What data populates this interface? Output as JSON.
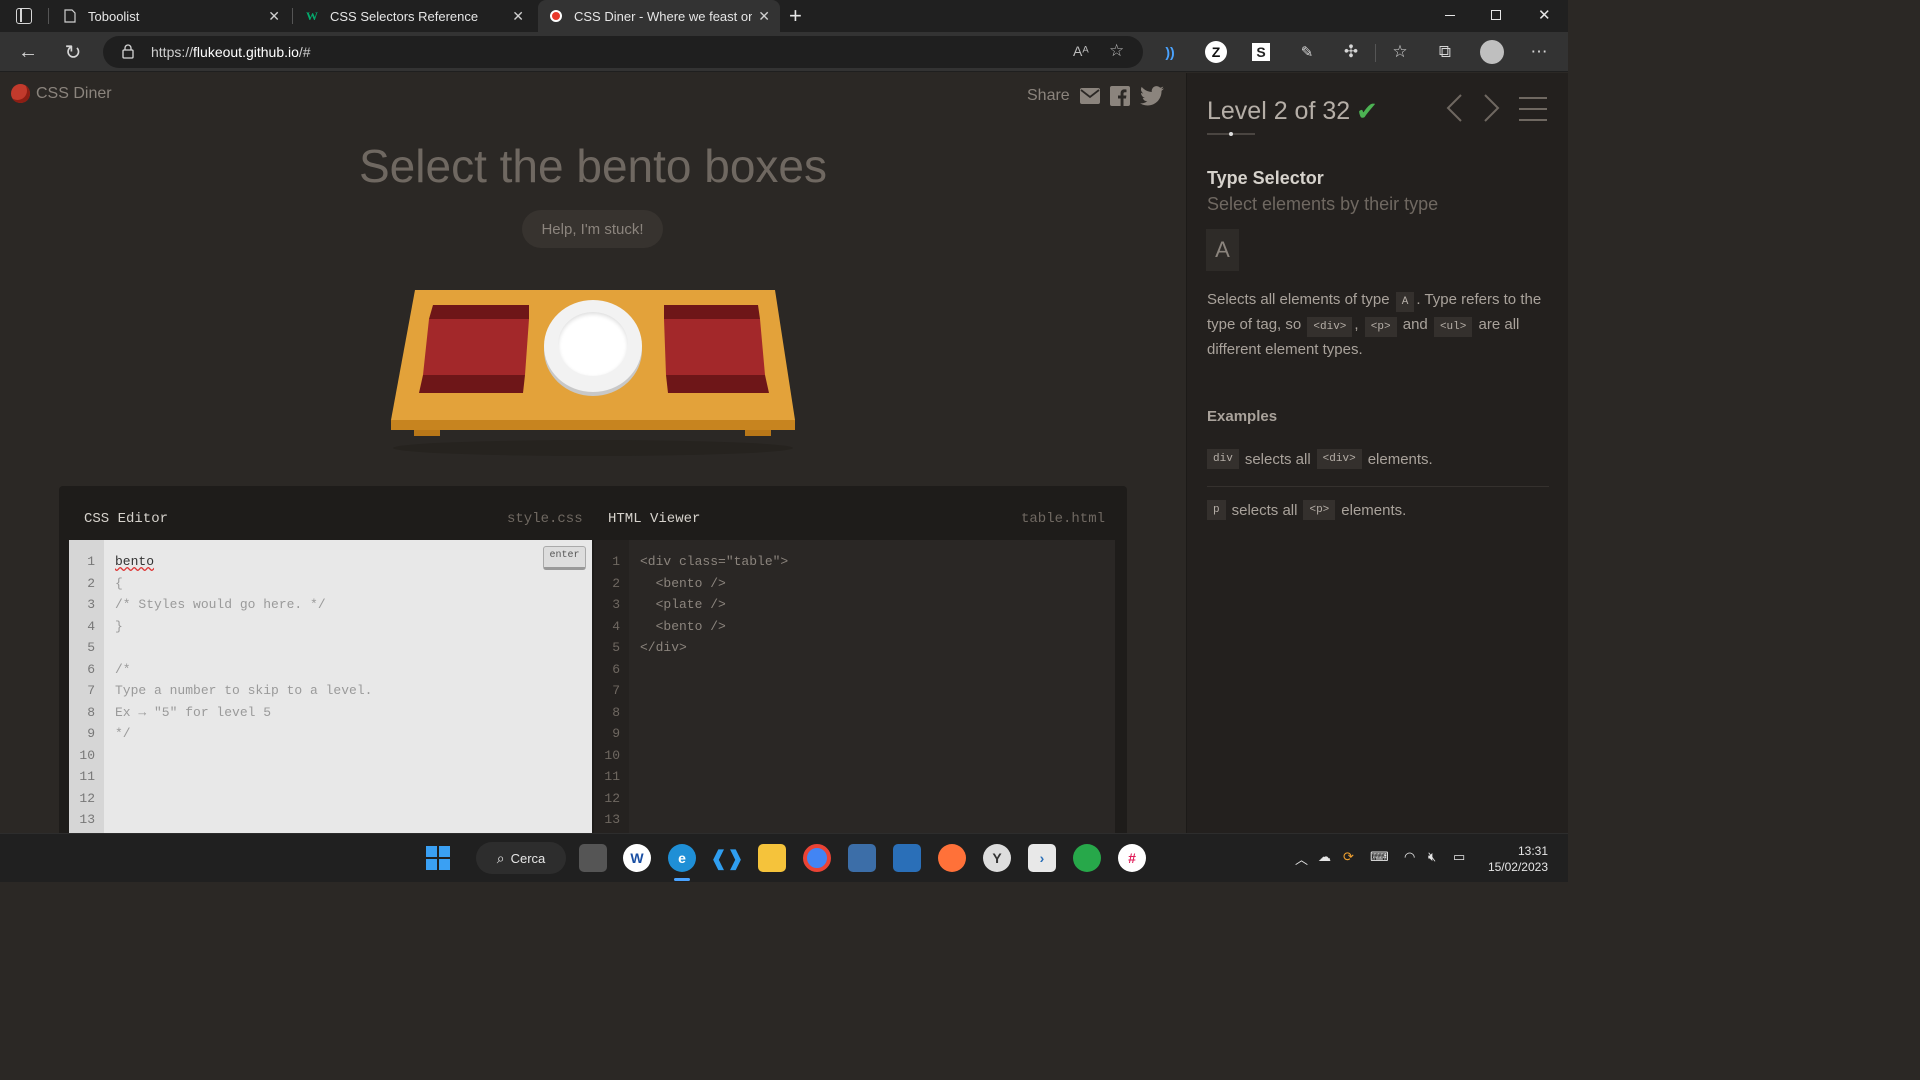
{
  "browser": {
    "tabs": [
      {
        "title": "Toboolist",
        "active": false
      },
      {
        "title": "CSS Selectors Reference",
        "active": false
      },
      {
        "title": "CSS Diner - Where we feast on C",
        "active": true
      }
    ],
    "url_scheme": "https://",
    "url_host": "flukeout.github.io",
    "url_path": "/#",
    "new_tab": "+",
    "window_controls": [
      "minimize",
      "restore",
      "close"
    ]
  },
  "page": {
    "logo_text": "CSS Diner",
    "share_label": "Share",
    "order_title": "Select the bento boxes",
    "help_button": "Help, I'm stuck!",
    "table_items": [
      "bento",
      "plate",
      "bento"
    ]
  },
  "css_editor": {
    "title": "CSS Editor",
    "filename": "style.css",
    "enter_label": "enter",
    "input_value": "bento",
    "lines": [
      "bento",
      "{",
      "/* Styles would go here. */",
      "}",
      "",
      "/*",
      "Type a number to skip to a level.",
      "Ex → \"5\" for level 5",
      "*/",
      "",
      "",
      "",
      ""
    ],
    "line_numbers": [
      "1",
      "2",
      "3",
      "4",
      "5",
      "6",
      "7",
      "8",
      "9",
      "10",
      "11",
      "12",
      "13"
    ]
  },
  "html_viewer": {
    "title": "HTML Viewer",
    "filename": "table.html",
    "lines": [
      "<div class=\"table\">",
      "  <bento />",
      "  <plate />",
      "  <bento />",
      "</div>",
      "",
      "",
      "",
      "",
      "",
      "",
      "",
      ""
    ],
    "line_numbers": [
      "1",
      "2",
      "3",
      "4",
      "5",
      "6",
      "7",
      "8",
      "9",
      "10",
      "11",
      "12",
      "13"
    ]
  },
  "sidebar": {
    "level_text": "Level 2 of 32",
    "completed": true,
    "selector_name": "Type Selector",
    "selector_subtitle": "Select elements by their type",
    "syntax": "A",
    "desc_1": "Selects all elements of type",
    "desc_tag_a": "A",
    "desc_2": ". Type refers to the type of tag, so",
    "desc_tag_div": "<div>",
    "desc_comma": ",",
    "desc_tag_p": "<p>",
    "desc_and": "and",
    "desc_tag_ul": "<ul>",
    "desc_3": "are all different element types.",
    "examples_title": "Examples",
    "examples": [
      {
        "code": "div",
        "text": "selects all",
        "tag": "<div>",
        "suffix": "elements."
      },
      {
        "code": "p",
        "text": "selects all",
        "tag": "<p>",
        "suffix": "elements."
      }
    ]
  },
  "taskbar": {
    "search_label": "Cerca",
    "time": "13:31",
    "date": "15/02/2023"
  },
  "colors": {
    "page_bg": "#2b2825",
    "sidebar_bg": "#23201e",
    "check_green": "#4cb253",
    "bento_red": "#a3282a",
    "table_orange": "#e3a23a"
  }
}
